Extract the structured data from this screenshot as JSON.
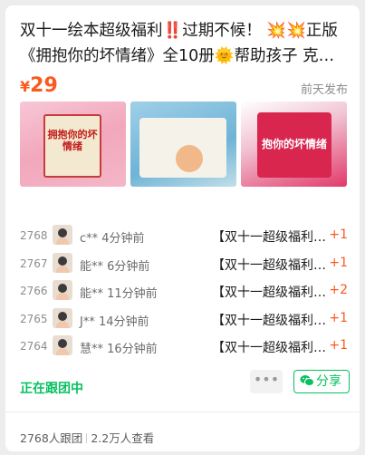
{
  "post": {
    "title": "双十一绘本超级福利‼️过期不候！ 💥💥正版《拥抱你的坏情绪》全10册🌞帮助孩子 克服任性、暴躁、胆小等坏情绪",
    "currency": "¥",
    "price": "29",
    "posted": "前天发布"
  },
  "images": [
    {
      "label": "拥抱你的坏情绪"
    },
    {
      "label": ""
    },
    {
      "label": "抱你的坏情绪"
    }
  ],
  "orders": [
    {
      "no": "2768",
      "who": "c** 4分钟前",
      "what": "【双十一超级福利…",
      "plus": "+1"
    },
    {
      "no": "2767",
      "who": "能** 6分钟前",
      "what": "【双十一超级福利…",
      "plus": "+1"
    },
    {
      "no": "2766",
      "who": "能** 11分钟前",
      "what": "【双十一超级福利…",
      "plus": "+2"
    },
    {
      "no": "2765",
      "who": "J** 14分钟前",
      "what": "【双十一超级福利…",
      "plus": "+1"
    },
    {
      "no": "2764",
      "who": "慧** 16分钟前",
      "what": "【双十一超级福利…",
      "plus": "+1"
    }
  ],
  "status": "正在跟团中",
  "more_label": "•••",
  "share_label": "分享",
  "footer": {
    "joined": "2768人跟团",
    "views": "2.2万人查看"
  },
  "colors": {
    "accent": "#07c160",
    "price": "#fa5a1e"
  }
}
